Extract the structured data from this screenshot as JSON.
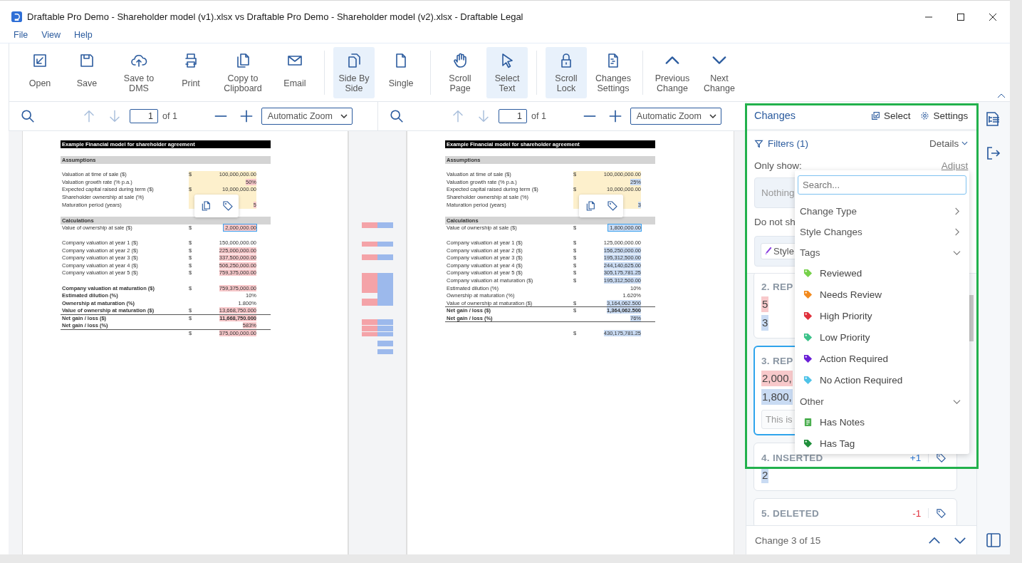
{
  "window": {
    "title": "Draftable Pro Demo - Shareholder model (v1).xlsx vs Draftable Pro Demo - Shareholder model (v2).xlsx - Draftable Legal"
  },
  "menu": [
    "File",
    "View",
    "Help"
  ],
  "toolbar": [
    [
      {
        "label": "Open",
        "selected": false
      },
      {
        "label": "Save",
        "selected": false
      },
      {
        "label": "Save to DMS",
        "selected": false
      },
      {
        "label": "Print",
        "selected": false
      },
      {
        "label": "Copy to Clipboard",
        "selected": false
      },
      {
        "label": "Email",
        "selected": false
      }
    ],
    [
      {
        "label": "Side By Side",
        "selected": true
      },
      {
        "label": "Single",
        "selected": false
      }
    ],
    [
      {
        "label": "Scroll Page",
        "selected": false
      },
      {
        "label": "Select Text",
        "selected": true
      }
    ],
    [
      {
        "label": "Scroll Lock",
        "selected": true
      },
      {
        "label": "Changes Settings",
        "selected": false
      }
    ],
    [
      {
        "label": "Previous Change",
        "selected": false
      },
      {
        "label": "Next Change",
        "selected": false
      }
    ]
  ],
  "viewers": [
    {
      "page": "1",
      "page_count": "of 1",
      "zoom": "Automatic Zoom",
      "rows": [
        {
          "kind": "title",
          "label": "Example Financial model for shareholder agreement"
        },
        {
          "kind": "blank"
        },
        {
          "kind": "section",
          "label": "Assumptions"
        },
        {
          "kind": "blank"
        },
        {
          "kind": "row",
          "label": "Valuation at time of sale ($)",
          "currency": "$",
          "value": "100,000,000.00",
          "changed": false,
          "input": true
        },
        {
          "kind": "row",
          "label": "Valuation growth rate (% p.a.)",
          "value": "50%",
          "changed": true,
          "input": true
        },
        {
          "kind": "row",
          "label": "Expected capital raised during term ($)",
          "currency": "$",
          "value": "10,000,000.00",
          "changed": false,
          "input": true
        },
        {
          "kind": "row",
          "label": "Shareholder ownership at sale (%)",
          "input": true
        },
        {
          "kind": "row",
          "label": "Maturation period (years)",
          "value": "5",
          "changed": true,
          "input": true
        },
        {
          "kind": "blank"
        },
        {
          "kind": "section",
          "label": "Calculations"
        },
        {
          "kind": "row",
          "label": "Value of ownership at sale ($)",
          "currency": "$",
          "value": "2,000,000.00",
          "changed": true,
          "input": false,
          "focus": true
        },
        {
          "kind": "blank"
        },
        {
          "kind": "row",
          "label": "Company valuation at year 1 ($)",
          "currency": "$",
          "value": "150,000,000.00",
          "changed": false,
          "input": false
        },
        {
          "kind": "row",
          "label": "Company valuation at year 2 ($)",
          "currency": "$",
          "value": "225,000,000.00",
          "changed": true,
          "input": false
        },
        {
          "kind": "row",
          "label": "Company valuation at year 3 ($)",
          "currency": "$",
          "value": "337,500,000.00",
          "changed": true,
          "input": false
        },
        {
          "kind": "row",
          "label": "Company valuation at year 4 ($)",
          "currency": "$",
          "value": "506,250,000.00",
          "changed": true,
          "input": false
        },
        {
          "kind": "row",
          "label": "Company valuation at year 5 ($)",
          "currency": "$",
          "value": "759,375,000.00",
          "changed": true,
          "input": false
        },
        {
          "kind": "blank"
        },
        {
          "kind": "row",
          "label": "Company valuation at maturation ($)",
          "bold": true,
          "currency": "$",
          "value": "759,375,000.00",
          "changed": true,
          "input": false
        },
        {
          "kind": "row",
          "label": "Estimated dilution (%)",
          "bold": true,
          "value": "10%",
          "changed": false,
          "input": false
        },
        {
          "kind": "row",
          "label": "Ownership at maturation (%)",
          "bold": true,
          "value": "1.800%",
          "changed": false,
          "input": false
        },
        {
          "kind": "row",
          "label": "Value of ownership at maturation ($)",
          "bold": true,
          "currency": "$",
          "value": "13,668,750.000",
          "changed": true,
          "input": false,
          "rule": true
        },
        {
          "kind": "row",
          "label": "Net gain / loss ($)",
          "bold": true,
          "currency": "$",
          "value": "11,668,750.000",
          "value_bold": true,
          "changed": true,
          "input": false
        },
        {
          "kind": "row",
          "label": "Net gain / loss (%)",
          "bold": true,
          "value": "583%",
          "changed": true,
          "input": false,
          "rule": true
        },
        {
          "kind": "row",
          "currency": "$",
          "value": "375,000,000.00",
          "changed": true,
          "input": false
        }
      ]
    },
    {
      "page": "1",
      "page_count": "of 1",
      "zoom": "Automatic Zoom",
      "rows": [
        {
          "kind": "title",
          "label": "Example Financial model for shareholder agreement"
        },
        {
          "kind": "blank"
        },
        {
          "kind": "section",
          "label": "Assumptions"
        },
        {
          "kind": "blank"
        },
        {
          "kind": "row",
          "label": "Valuation at time of sale ($)",
          "currency": "$",
          "value": "100,000,000.00",
          "changed": false,
          "input": true
        },
        {
          "kind": "row",
          "label": "Valuation growth rate (% p.a.)",
          "value": "25%",
          "changed": true,
          "input": true
        },
        {
          "kind": "row",
          "label": "Expected capital raised during term ($)",
          "currency": "$",
          "value": "10,000,000.00",
          "changed": false,
          "input": true
        },
        {
          "kind": "row",
          "label": "Shareholder ownership at sale (%)",
          "input": true
        },
        {
          "kind": "row",
          "label": "Maturation period (years)",
          "value": "3",
          "changed": true,
          "input": true
        },
        {
          "kind": "blank"
        },
        {
          "kind": "section",
          "label": "Calculations"
        },
        {
          "kind": "row",
          "label": "Value of ownership at sale ($)",
          "currency": "$",
          "value": "1,800,000.00",
          "changed": true,
          "input": false,
          "focus": true
        },
        {
          "kind": "blank"
        },
        {
          "kind": "row",
          "label": "Company valuation at year 1 ($)",
          "currency": "$",
          "value": "125,000,000.00",
          "changed": false,
          "input": false
        },
        {
          "kind": "row",
          "label": "Company valuation at year 2 ($)",
          "currency": "$",
          "value": "156,250,000.00",
          "changed": true,
          "input": false
        },
        {
          "kind": "row",
          "label": "Company valuation at year 3 ($)",
          "currency": "$",
          "value": "195,312,500.00",
          "changed": true,
          "input": false
        },
        {
          "kind": "row",
          "label": "Company valuation at year 4 ($)",
          "currency": "$",
          "value": "244,140,625.00",
          "changed": true,
          "input": false
        },
        {
          "kind": "row",
          "label": "Company valuation at year 5 ($)",
          "currency": "$",
          "value": "305,175,781.25",
          "changed": true,
          "input": false
        },
        {
          "kind": "row",
          "label": "Company valuation at maturation ($)",
          "currency": "$",
          "value": "195,312,500.00",
          "changed": true,
          "input": false
        },
        {
          "kind": "row",
          "label": "Estimated dilution (%)",
          "value": "10%",
          "changed": false,
          "input": false
        },
        {
          "kind": "row",
          "label": "Ownership at maturation (%)",
          "value": "1.620%",
          "changed": false,
          "input": false
        },
        {
          "kind": "row",
          "label": "Value of ownership at maturation ($)",
          "currency": "$",
          "value": "3,164,062.500",
          "changed": true,
          "input": false,
          "rule": true
        },
        {
          "kind": "row",
          "label": "Net gain / loss ($)",
          "bold": true,
          "currency": "$",
          "value": "1,364,062.500",
          "value_bold": true,
          "changed": true,
          "input": false
        },
        {
          "kind": "row",
          "label": "Net gain / loss (%)",
          "bold": true,
          "value": "76%",
          "changed": true,
          "input": false,
          "rule": true
        },
        {
          "kind": "blank"
        },
        {
          "kind": "row",
          "currency": "$",
          "value": "430,175,781.25",
          "changed": true,
          "input": false
        }
      ]
    }
  ],
  "changes_panel": {
    "title": "Changes",
    "select": "Select",
    "settings": "Settings",
    "filters": "Filters (1)",
    "details": "Details",
    "only_show": "Only show:",
    "adjust": "Adjust",
    "only_show_box": "Nothing",
    "do_not_show": "Do not sh",
    "chip": "Style",
    "cards": [
      {
        "title": "2. REP",
        "selected": false,
        "old": "5",
        "new": "3"
      },
      {
        "title": "3. REP",
        "selected": true,
        "old": "2,000,",
        "new": "1,800,",
        "note": "This is"
      },
      {
        "title": "4. INSERTED",
        "kind": "inserted",
        "selected": false,
        "count": "+1",
        "new": "2"
      },
      {
        "title": "5. DELETED",
        "kind": "deleted",
        "selected": false,
        "count": "-1"
      }
    ],
    "footer": "Change 3 of 15",
    "dropdown": {
      "placeholder": "Search...",
      "groups": [
        {
          "label": "Change Type",
          "expanded": false
        },
        {
          "label": "Style Changes",
          "expanded": false
        },
        {
          "label": "Tags",
          "expanded": true,
          "items": [
            {
              "label": "Reviewed",
              "kind": "tag",
              "color": "#76d14a"
            },
            {
              "label": "Needs Review",
              "kind": "tag",
              "color": "#f28a1e"
            },
            {
              "label": "High Priority",
              "kind": "tag",
              "color": "#e0303c"
            },
            {
              "label": "Low Priority",
              "kind": "tag",
              "color": "#3cc28a"
            },
            {
              "label": "Action Required",
              "kind": "tag",
              "color": "#6a1fd6"
            },
            {
              "label": "No Action Required",
              "kind": "tag",
              "color": "#4fc3e8"
            }
          ]
        },
        {
          "label": "Other",
          "expanded": true,
          "items": [
            {
              "label": "Has Notes",
              "kind": "note",
              "color": "#4caf50"
            },
            {
              "label": "Has Tag",
              "kind": "tag",
              "color": "#1f8f3a"
            }
          ]
        }
      ]
    }
  }
}
